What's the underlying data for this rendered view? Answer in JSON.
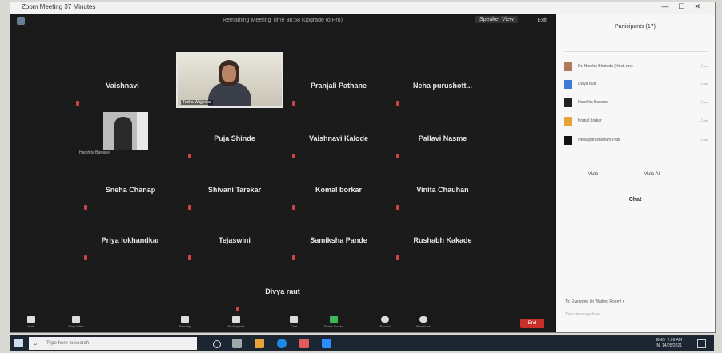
{
  "window": {
    "title": "Zoom Meeting 37 Minutes"
  },
  "topbar": {
    "center_text": "Remaining Meeting Time 38:58 (upgrade to Pro)",
    "view_label": "Speaker View",
    "right_label": "Exit"
  },
  "tiles": [
    {
      "name": "Vaishnavi"
    },
    {
      "name": "Pranjali Pathane"
    },
    {
      "name": "Neha  purushott..."
    },
    {
      "name": "Puja Shinde"
    },
    {
      "name": "Vaishnavi Kalode"
    },
    {
      "name": "Pallavi Nasme"
    },
    {
      "name": "Sneha Chanap"
    },
    {
      "name": "Shivani Tarekar"
    },
    {
      "name": "Komal borkar"
    },
    {
      "name": "Vinita Chauhan"
    },
    {
      "name": "Priya lokhandkar"
    },
    {
      "name": "Tejaswini"
    },
    {
      "name": "Samiksha Pande"
    },
    {
      "name": "Rushabh Kakade"
    },
    {
      "name": "Divya raut"
    }
  ],
  "video_labels": {
    "video1": "Trisha Wajjmkar",
    "video2": "Harshita Bawane"
  },
  "toolbar": {
    "items": [
      {
        "label": "Mute",
        "icon": "microphone-icon"
      },
      {
        "label": "Stop Video",
        "icon": "video-camera-icon"
      },
      {
        "label": "Security",
        "icon": "shield-icon"
      },
      {
        "label": "Participants",
        "icon": "participants-icon"
      },
      {
        "label": "Chat",
        "icon": "chat-icon"
      },
      {
        "label": "Share Screen",
        "icon": "share-screen-icon"
      },
      {
        "label": "Record",
        "icon": "record-icon"
      },
      {
        "label": "Reactions",
        "icon": "reactions-icon"
      }
    ],
    "end_label": "End"
  },
  "panel": {
    "title": "Participants (17)",
    "participants": [
      {
        "name": "Dr. Harsha Bhutada (Host, me)",
        "color": "#b07a5a"
      },
      {
        "name": "Divya raut",
        "color": "#3a7bd5"
      },
      {
        "name": "Harshita Bawane",
        "color": "#222222"
      },
      {
        "name": "Komal borkar",
        "color": "#e8a23a"
      },
      {
        "name": "Neha purushottam Patil",
        "color": "#111111"
      }
    ],
    "mute_all": "Mute",
    "unmute_all": "Mute All",
    "chat_title": "Chat",
    "chat_to": "To: Everyone (in Waiting Room) ▾",
    "chat_placeholder": "Type message here..."
  },
  "taskbar": {
    "search_placeholder": "Type here to search",
    "tray_lang": "ENG",
    "tray_region": "IN",
    "time": "2:09 AM",
    "date": "14/05/2021"
  }
}
